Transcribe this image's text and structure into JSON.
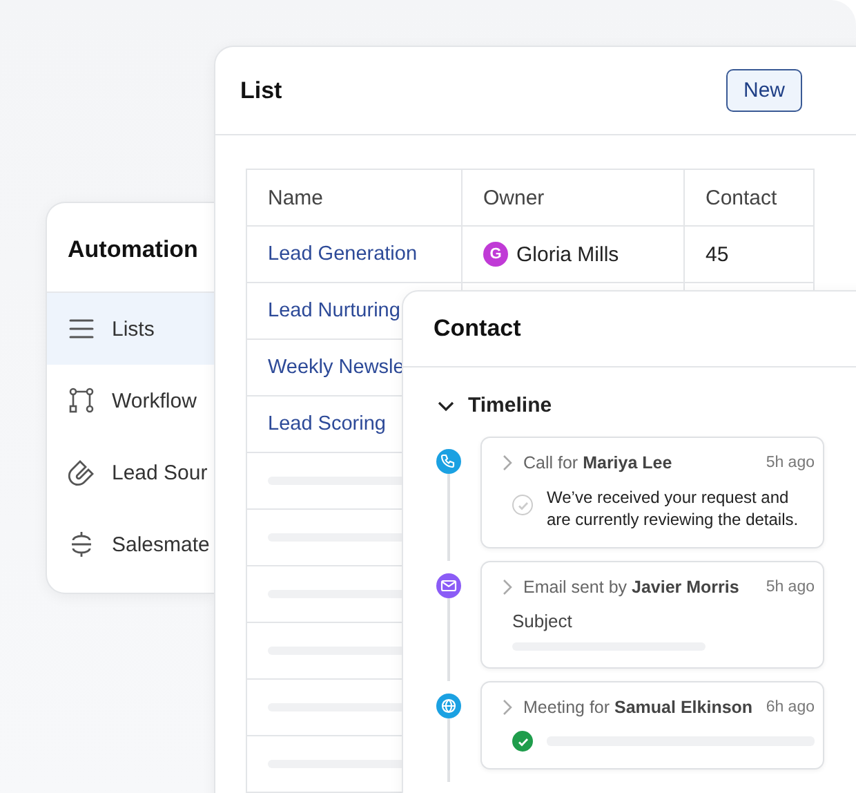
{
  "sidebar": {
    "title": "Automation",
    "items": [
      {
        "label": "Lists",
        "selected": true
      },
      {
        "label": "Workflow",
        "selected": false
      },
      {
        "label": "Lead Sour",
        "selected": false
      },
      {
        "label": "Salesmate",
        "selected": false
      }
    ]
  },
  "list": {
    "title": "List",
    "new_button": "New",
    "columns": [
      "Name",
      "Owner",
      "Contact"
    ],
    "rows": [
      {
        "name": "Lead Generation",
        "owner": {
          "initial": "G",
          "name": "Gloria Mills"
        },
        "contact": "45"
      },
      {
        "name": "Lead Nurturing"
      },
      {
        "name": "Weekly Newsle"
      },
      {
        "name": "Lead Scoring"
      }
    ]
  },
  "contact": {
    "title": "Contact",
    "section": {
      "label": "Timeline",
      "expanded": true
    },
    "timeline": [
      {
        "kind": "call",
        "color": "#1ba1e2",
        "title": "Call for **Mariya Lee**",
        "time": "5h ago",
        "done": false,
        "text": "We’ve received your request and are currently reviewing the details."
      },
      {
        "kind": "email",
        "color": "#8b5cf6",
        "title": "Email sent by **Javier Morris**",
        "time": "5h ago",
        "text": "Subject"
      },
      {
        "kind": "meeting",
        "color": "#1ba1e2",
        "title": "Meeting for **Samual Elkinson**",
        "time": "6h ago",
        "done": true
      }
    ]
  }
}
